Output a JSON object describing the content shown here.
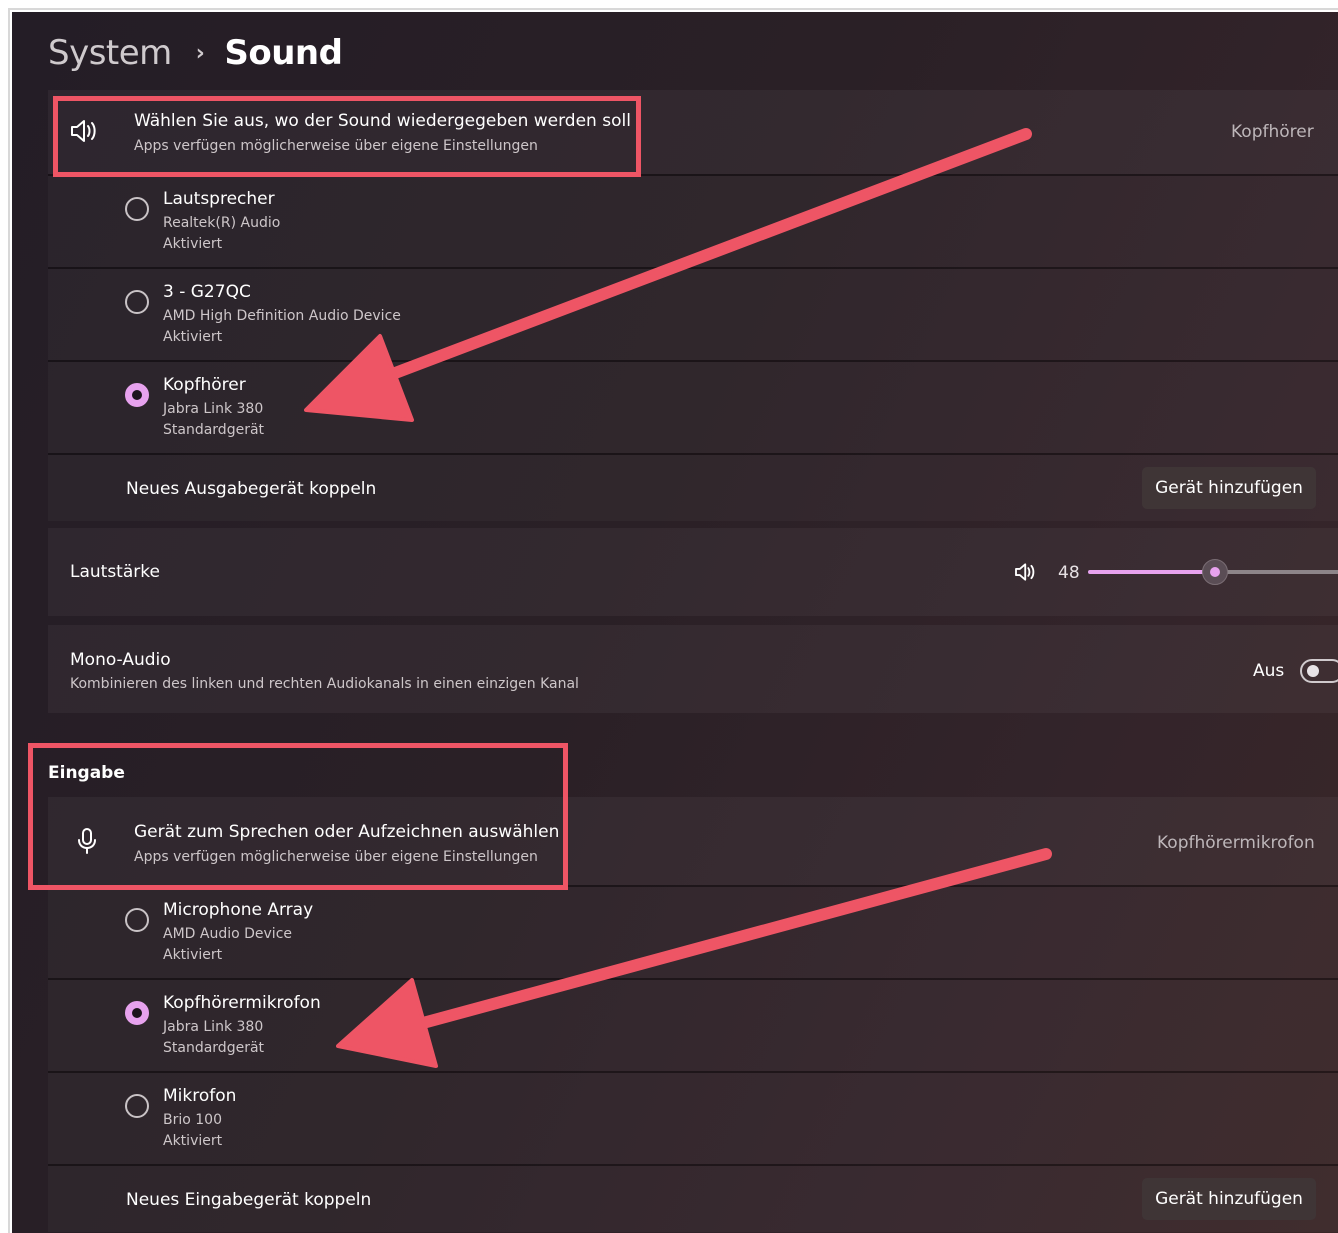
{
  "breadcrumb": {
    "parent": "System",
    "separator": "›",
    "current": "Sound"
  },
  "output": {
    "header_title": "Wählen Sie aus, wo der Sound wiedergegeben werden soll",
    "header_desc": "Apps verfügen möglicherweise über eigene Einstellungen",
    "selected_value": "Kopfhörer",
    "devices": [
      {
        "name": "Lautsprecher",
        "driver": "Realtek(R) Audio",
        "status": "Aktiviert",
        "selected": false
      },
      {
        "name": "3 - G27QC",
        "driver": "AMD High Definition Audio Device",
        "status": "Aktiviert",
        "selected": false
      },
      {
        "name": "Kopfhörer",
        "driver": "Jabra Link 380",
        "status": "Standardgerät",
        "selected": true
      }
    ],
    "pair_label": "Neues Ausgabegerät koppeln",
    "pair_button": "Gerät hinzufügen"
  },
  "volume": {
    "label": "Lautstärke",
    "value": "48",
    "fraction": 0.48
  },
  "mono": {
    "title": "Mono-Audio",
    "desc": "Kombinieren des linken und rechten Audiokanals in einen einzigen Kanal",
    "state": "Aus"
  },
  "input": {
    "section_label": "Eingabe",
    "header_title": "Gerät zum Sprechen oder Aufzeichnen auswählen",
    "header_desc": "Apps verfügen möglicherweise über eigene Einstellungen",
    "selected_value": "Kopfhörermikrofon",
    "devices": [
      {
        "name": "Microphone Array",
        "driver": "AMD Audio Device",
        "status": "Aktiviert",
        "selected": false
      },
      {
        "name": "Kopfhörermikrofon",
        "driver": "Jabra Link 380",
        "status": "Standardgerät",
        "selected": true
      },
      {
        "name": "Mikrofon",
        "driver": "Brio 100",
        "status": "Aktiviert",
        "selected": false
      }
    ],
    "pair_label": "Neues Eingabegerät koppeln",
    "pair_button": "Gerät hinzufügen"
  },
  "colors": {
    "accent": "#e7a2ee",
    "annotation": "#ee5565"
  },
  "icons": {
    "speaker": "speaker-icon",
    "microphone": "microphone-icon"
  }
}
